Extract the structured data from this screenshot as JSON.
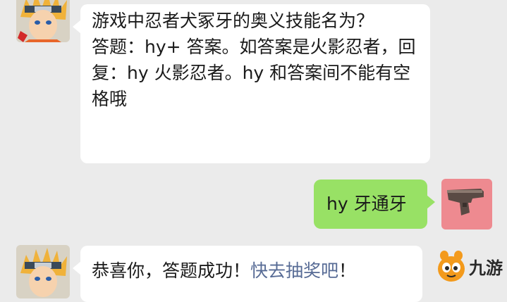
{
  "messages": [
    {
      "sender": "official-account",
      "avatar_icon": "naruto-avatar-icon",
      "paragraphs": [
        "游戏中忍者犬冢牙的奥义技能名为？",
        "答题：hy+ 答案。如答案是火影忍者，回复：hy 火影忍者。hy 和答案间不能有空格哦"
      ]
    },
    {
      "sender": "user",
      "avatar_icon": "pistol-avatar-icon",
      "text": "hy 牙通牙"
    },
    {
      "sender": "official-account",
      "avatar_icon": "naruto-avatar-icon",
      "text_before": "恭喜你，答题成功！",
      "link_text": "快去抽奖吧",
      "text_after": "！"
    }
  ],
  "watermark": {
    "text": "九游",
    "icon": "jiuyou-logo-icon"
  },
  "colors": {
    "background": "#ebebeb",
    "incoming_bubble": "#ffffff",
    "outgoing_bubble": "#98e165",
    "link": "#576b95"
  }
}
